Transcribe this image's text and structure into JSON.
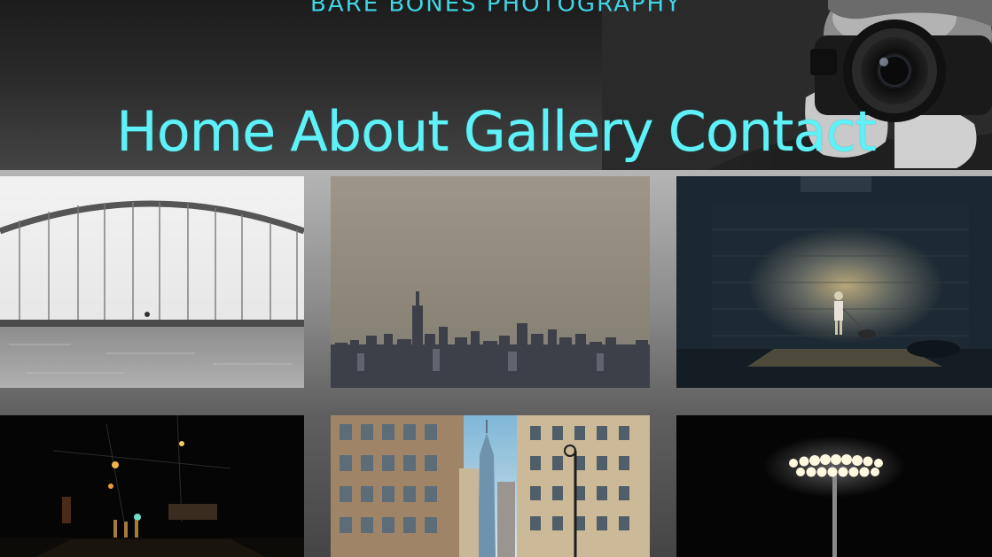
{
  "site": {
    "title": "BARE BONES PHOTOGRAPHY",
    "accent_color": "#5ef2f8"
  },
  "nav": {
    "items": [
      {
        "label": "Home"
      },
      {
        "label": "About"
      },
      {
        "label": "Gallery"
      },
      {
        "label": "Contact"
      }
    ]
  },
  "hero": {
    "icon": "photographer-with-camera-image"
  },
  "gallery": {
    "tiles": [
      {
        "icon": "arch-bridge-photo"
      },
      {
        "icon": "city-skyline-photo"
      },
      {
        "icon": "person-walking-dog-photo"
      },
      {
        "icon": "night-street-photo"
      },
      {
        "icon": "downtown-buildings-photo"
      },
      {
        "icon": "stadium-light-photo"
      }
    ]
  }
}
